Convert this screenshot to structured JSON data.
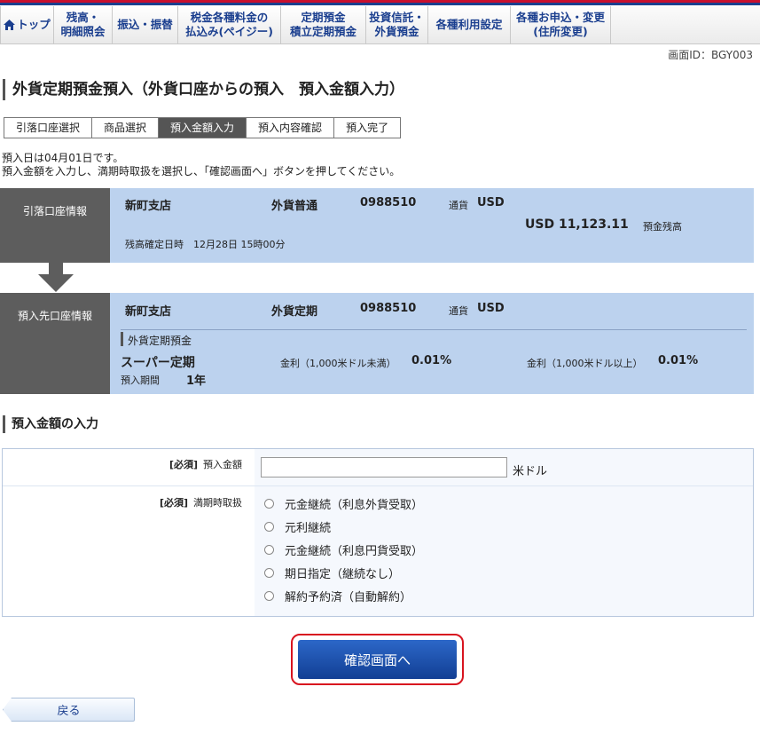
{
  "nav": {
    "items": [
      "トップ",
      "残高・\n明細照会",
      "振込・振替",
      "税金各種料金の\n払込み(ペイジー)",
      "定期預金\n積立定期預金",
      "投資信託・\n外貨預金",
      "各種利用設定",
      "各種お申込・変更\n(住所変更)"
    ]
  },
  "screen_id": "画面ID：BGY003",
  "page_title": "外貨定期預金預入（外貨口座からの預入　預入金額入力）",
  "steps": [
    "引落口座選択",
    "商品選択",
    "預入金額入力",
    "預入内容確認",
    "預入完了"
  ],
  "active_step": "預入金額入力",
  "instructions": [
    "預入日は04月01日です。",
    "預入金額を入力し、満期時取扱を選択し、「確認画面へ」ボタンを押してください。"
  ],
  "withdrawal": {
    "label": "引落口座情報",
    "branch": "新町支店",
    "type": "外貨普通",
    "number": "0988510",
    "currency_label": "通貨",
    "currency": "USD",
    "balance": "USD 11,123.11",
    "balance_label": "預金残高",
    "confirm_time": "残高確定日時　12月28日 15時00分"
  },
  "deposit": {
    "label": "預入先口座情報",
    "branch": "新町支店",
    "type": "外貨定期",
    "number": "0988510",
    "currency_label": "通貨",
    "currency": "USD",
    "product_category": "外貨定期預金",
    "product_name": "スーパー定期",
    "term_label": "預入期間",
    "term": "1年",
    "rate1_label": "金利（1,000米ドル未満）",
    "rate1": "0.01%",
    "rate2_label": "金利（1,000米ドル以上）",
    "rate2": "0.01%"
  },
  "section_title": "預入金額の入力",
  "form": {
    "required": "[必須]",
    "amount_label": "預入金額",
    "amount_value": "",
    "unit": "米ドル",
    "maturity_label": "満期時取扱",
    "options": [
      "元金継続（利息外貨受取）",
      "元利継続",
      "元金継続（利息円貨受取）",
      "期日指定（継続なし）",
      "解約予約済（自動解約）"
    ]
  },
  "confirm_button": "確認画面へ",
  "back_button": "戻る",
  "colors": {
    "brand_blue": "#1b3f8f",
    "brand_red": "#c8102e",
    "panel_blue": "#bcd2ee",
    "label_gray": "#5d5d5d",
    "highlight_red": "#d8141f"
  }
}
